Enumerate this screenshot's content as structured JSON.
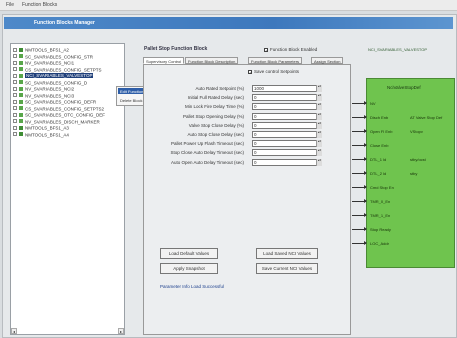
{
  "menubar": {
    "file": "File",
    "view": "Function Blocks"
  },
  "title": "Function Blocks Manager",
  "tree": {
    "items": [
      {
        "label": "NMTOOLS_BFS1_A2",
        "selected": false,
        "green": true
      },
      {
        "label": "SC_SVARIABLES_CONFIG_STR",
        "selected": false,
        "green": false
      },
      {
        "label": "NV_SVARIABLES_NCI1",
        "selected": false,
        "green": false
      },
      {
        "label": "CS_SVARIABLES_CONFIG_SETPTS",
        "selected": false,
        "green": false
      },
      {
        "label": "NCI_SVARIABLES_VALVESTOP",
        "selected": true,
        "green": false
      },
      {
        "label": "SC_SVARIABLES_CONFIG_D",
        "selected": false,
        "green": false
      },
      {
        "label": "NV_SVARIABLES_NCI2",
        "selected": false,
        "green": false
      },
      {
        "label": "NV_SVARIABLES_NCI3",
        "selected": false,
        "green": false
      },
      {
        "label": "SC_SVARIABLES_CONFIG_DEFR",
        "selected": false,
        "green": false
      },
      {
        "label": "CS_SVARIABLES_CONFIG_SETPTS2",
        "selected": false,
        "green": false
      },
      {
        "label": "SC_SVARIABLES_OTC_CONFIG_DEF",
        "selected": false,
        "green": false
      },
      {
        "label": "NV_SVARIABLES_DISCH_MARKER",
        "selected": false,
        "green": false
      },
      {
        "label": "NMTOOLS_BFS1_A3",
        "selected": false,
        "green": true
      },
      {
        "label": "NMTOOLS_BFS1_A4",
        "selected": false,
        "green": true
      }
    ]
  },
  "context_menu": {
    "items": [
      "Edit Function Block",
      "Delete Block"
    ]
  },
  "main": {
    "title": "Pallet Stop Function Block",
    "enable_label": "Function Block Enabled",
    "right_label": "NCI_SVARIABLES_VALVESTOP",
    "tabs": [
      "Supervisory Control",
      "Function Block Description",
      "Function Block Parameters",
      "Assign Section"
    ],
    "save_control_label": "Save control Setpoints",
    "fields": [
      {
        "label": "Auto Rated Setpoint (%)",
        "value": "1000"
      },
      {
        "label": "Initial Full Rated Delay (sec)",
        "value": "0"
      },
      {
        "label": "Min Lock Fire Delay Time (%)",
        "value": "0"
      },
      {
        "label": "Pallet Stop Opening Delay (%)",
        "value": "0"
      },
      {
        "label": "Valve Stop Close Delay (%)",
        "value": "0"
      },
      {
        "label": "Auto Stop Close Delay (sec)",
        "value": "0"
      },
      {
        "label": "Pallet Power Up Flash Timeout (sec)",
        "value": "0"
      },
      {
        "label": "Stop Close Auto Delay Timeout (sec)",
        "value": "0"
      },
      {
        "label": "Auto Open Auto Delay Timeout (sec)",
        "value": "0"
      }
    ],
    "buttons": {
      "load_default": "Load Default Values",
      "load_saved": "Load Saved NCI Values",
      "apply_snapshot": "Apply Snapshot",
      "save_current": "Save Current NCI Values"
    },
    "link": "Parameter Info Load Successful"
  },
  "green_panel": {
    "header": "NciValveStopDef",
    "signals": [
      {
        "name": "NV",
        "value": ""
      },
      {
        "name": "Disch Enb",
        "value": "AT Valve Stop Def"
      },
      {
        "name": "Open Fl Enb",
        "value": "VStopv"
      },
      {
        "name": "Close Enb",
        "value": ""
      },
      {
        "name": "DTL_1 ld",
        "value": "stby/ocst"
      },
      {
        "name": "DTL_2 ld",
        "value": "stby"
      },
      {
        "name": "Cmd Stop En",
        "value": ""
      },
      {
        "name": "TMR_0_En",
        "value": ""
      },
      {
        "name": "TMR_1_En",
        "value": ""
      },
      {
        "name": "Stop Ready",
        "value": ""
      },
      {
        "name": "LOC_Addr",
        "value": ""
      }
    ]
  }
}
